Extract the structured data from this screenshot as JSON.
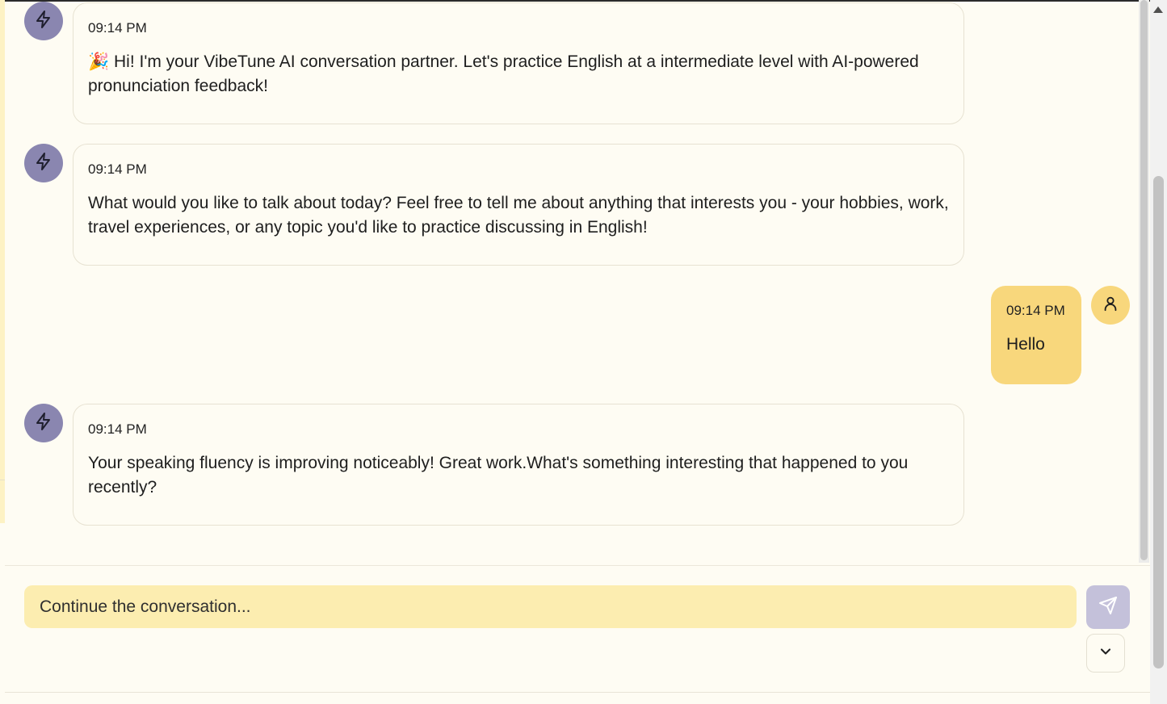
{
  "messages": [
    {
      "role": "ai",
      "time": "09:14 PM",
      "emoji": "🎉",
      "text": "Hi! I'm your VibeTune AI conversation partner. Let's practice English at a intermediate level with AI-powered pronunciation feedback!"
    },
    {
      "role": "ai",
      "time": "09:14 PM",
      "text": "What would you like to talk about today? Feel free to tell me about anything that interests you - your hobbies, work, travel experiences, or any topic you'd like to practice discussing in English!"
    },
    {
      "role": "user",
      "time": "09:14 PM",
      "text": "Hello"
    },
    {
      "role": "ai",
      "time": "09:14 PM",
      "text": "Your speaking fluency is improving noticeably! Great work.What's something interesting that happened to you recently?"
    }
  ],
  "composer": {
    "placeholder": "Continue the conversation..."
  },
  "icons": {
    "ai_avatar": "lightning-icon",
    "user_avatar": "user-icon",
    "send": "send-icon",
    "scroll_down": "chevron-down-icon"
  },
  "colors": {
    "ai_avatar": "#8a86b0",
    "user_bubble": "#f8d77c",
    "composer_bg": "#fcedb0",
    "send_button": "#c4c1da",
    "background": "#fefcf3"
  }
}
